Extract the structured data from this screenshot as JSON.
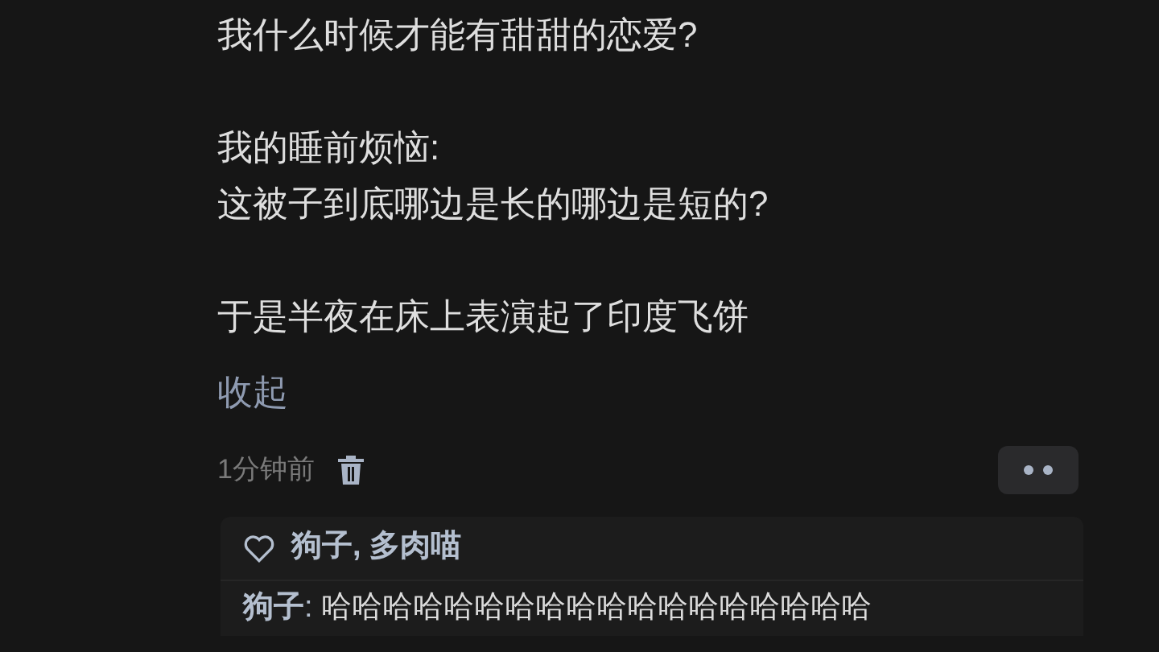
{
  "paragraphs": [
    "我什么时候才能有甜甜的恋爱?",
    "我的睡前烦恼:\n这被子到底哪边是长的哪边是短的?",
    "于是半夜在床上表演起了印度飞饼"
  ],
  "collapse_link": "收起",
  "timestamp": "1分钟前",
  "likes": {
    "names": "狗子, 多肉喵"
  },
  "replies": [
    {
      "author": "狗子",
      "separator": ": ",
      "text": "哈哈哈哈哈哈哈哈哈哈哈哈哈哈哈哈哈哈"
    }
  ]
}
